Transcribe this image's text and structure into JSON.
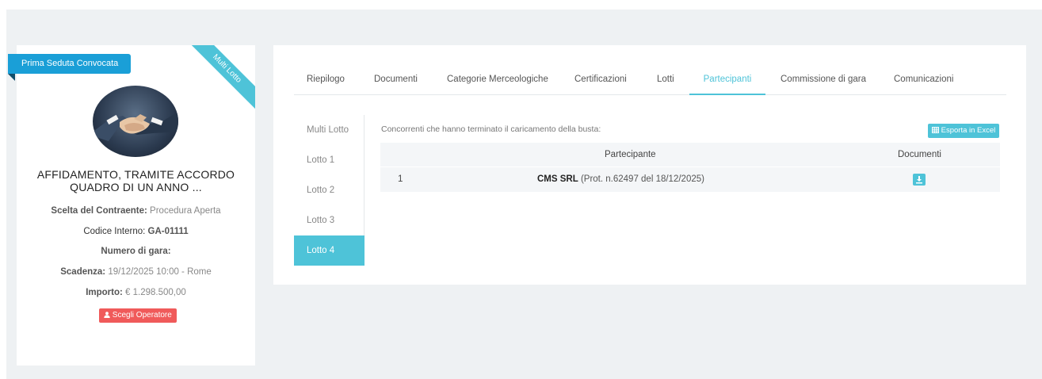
{
  "card": {
    "status": "Prima Seduta Convocata",
    "corner_label": "Multi Lotto",
    "title_line1": "AFFIDAMENTO, TRAMITE ACCORDO",
    "title_line2": "QUADRO DI UN ANNO ...",
    "scelta_label": "Scelta del Contraente:",
    "scelta_value": "Procedura Aperta",
    "codice_label": "Codice Interno:",
    "codice_value": "GA-01111",
    "numero_label": "Numero di gara:",
    "scadenza_label": "Scadenza:",
    "scadenza_value": "19/12/2025 10:00 - Rome",
    "importo_label": "Importo:",
    "importo_value": "€ 1.298.500,00",
    "operator_button": "Scegli Operatore"
  },
  "tabs": [
    {
      "label": "Riepilogo"
    },
    {
      "label": "Documenti"
    },
    {
      "label": "Categorie Merceologiche"
    },
    {
      "label": "Certificazioni"
    },
    {
      "label": "Lotti"
    },
    {
      "label": "Partecipanti"
    },
    {
      "label": "Commissione di gara"
    },
    {
      "label": "Comunicazioni"
    }
  ],
  "active_tab": "Partecipanti",
  "lots": [
    {
      "label": "Multi Lotto"
    },
    {
      "label": "Lotto 1"
    },
    {
      "label": "Lotto 2"
    },
    {
      "label": "Lotto 3"
    },
    {
      "label": "Lotto 4"
    }
  ],
  "active_lot": "Lotto 4",
  "content": {
    "caption": "Concorrenti che hanno terminato il caricamento della busta:",
    "excel_button": "Esporta in Excel",
    "columns": [
      "Partecipante",
      "Documenti"
    ],
    "rows": [
      {
        "index": "1",
        "name": "CMS SRL",
        "protocol": "(Prot. n.62497 del 18/12/2025)"
      }
    ]
  },
  "colors": {
    "accent": "#4ec3d8",
    "status_blue": "#1a9fd7",
    "danger": "#f05a5a"
  },
  "icons": {
    "excel": "table-icon",
    "operator": "user-icon",
    "download": "download-icon"
  }
}
